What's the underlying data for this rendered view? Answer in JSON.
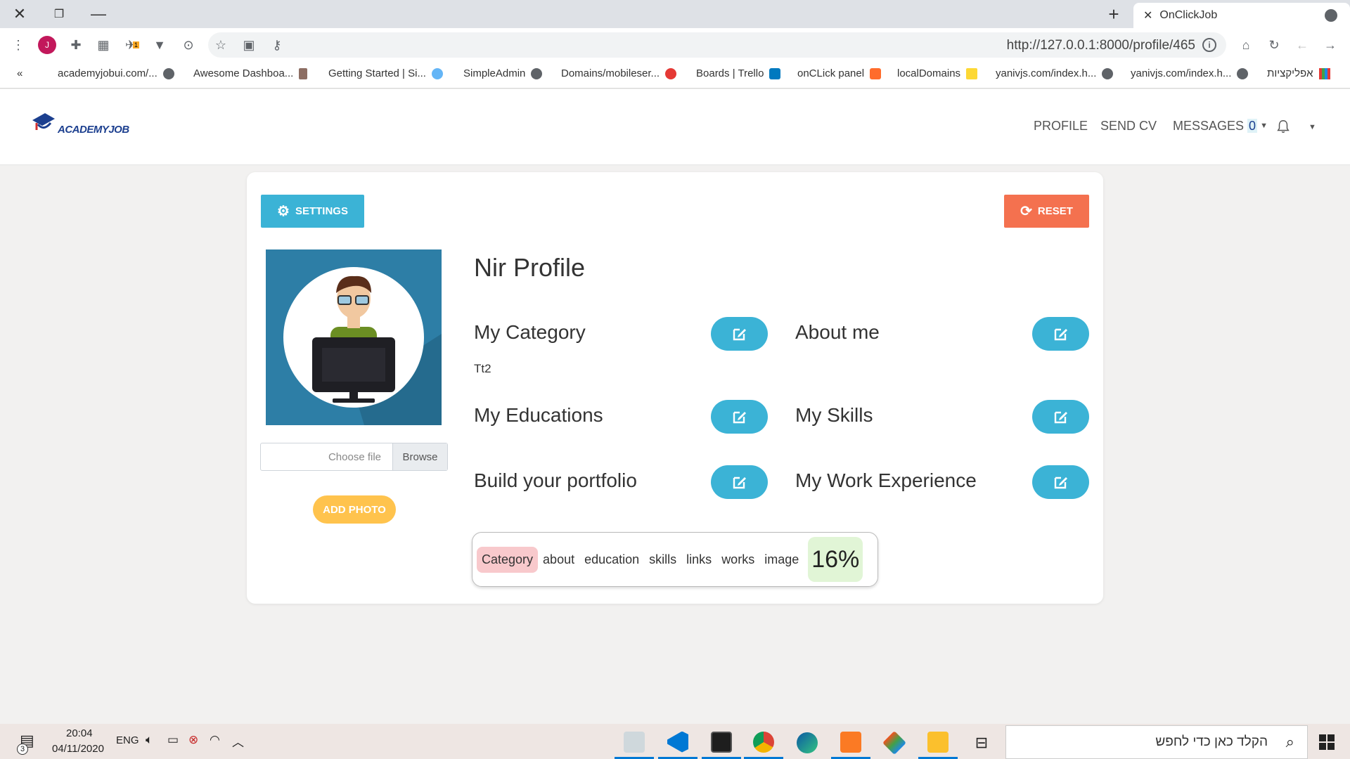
{
  "browser": {
    "tab_title": "OnClickJob",
    "new_tab": "+",
    "url": "http://127.0.0.1:8000/profile/465",
    "profile_initial": "J",
    "extension_badge": "1",
    "bookmarks_overflow": "«",
    "bookmarks": [
      "academyjobui.com/...",
      "Awesome Dashboa...",
      "Getting Started | Si...",
      "SimpleAdmin",
      "Domains/mobileser...",
      "Boards | Trello",
      "onCLick panel",
      "localDomains",
      "yanivjs.com/index.h...",
      "yanivjs.com/index.h...",
      "אפליקציות"
    ]
  },
  "navbar": {
    "logo_text": "ACADEMYJOB",
    "items": {
      "profile": "PROFILE",
      "send_cv": "SEND CV",
      "messages": "MESSAGES",
      "messages_count": "0"
    }
  },
  "page": {
    "settings_label": "SETTINGS",
    "reset_label": "RESET",
    "profile_title": "Nir Profile",
    "file_input": {
      "placeholder": "Choose file",
      "browse": "Browse"
    },
    "add_photo_label": "ADD PHOTO",
    "sections": {
      "category": "My Category",
      "category_value": "Tt2",
      "about": "About me",
      "educations": "My Educations",
      "skills": "My Skills",
      "portfolio": "Build your portfolio",
      "work_experience": "My Work Experience"
    },
    "progress": {
      "steps": [
        "Category",
        "about",
        "education",
        "skills",
        "links",
        "works",
        "image"
      ],
      "active_step": "Category",
      "percent": "16%",
      "percent_value": 16
    },
    "colors": {
      "primary": "#3bb3d6",
      "danger": "#f4714f",
      "warning": "#ffc34d"
    }
  },
  "taskbar": {
    "time": "20:04",
    "date": "04/11/2020",
    "lang": "ENG",
    "notifications": "3",
    "search_placeholder": "הקלד כאן כדי לחפש"
  }
}
